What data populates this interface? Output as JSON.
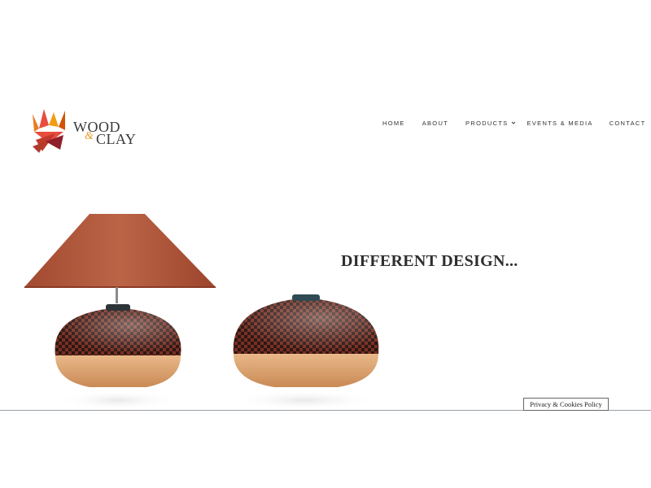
{
  "brand": {
    "word1": "WOOD",
    "ampersand": "&",
    "word2": "CLAY"
  },
  "nav": {
    "home": "HOME",
    "about": "ABOUT",
    "products": "PRODUCTS",
    "events_media": "EVENTS & MEDIA",
    "contact": "CONTACT"
  },
  "hero": {
    "title": "DIFFERENT DESIGN..."
  },
  "footer": {
    "privacy_label": "Privacy & Cookies Policy"
  },
  "colors": {
    "brand_orange": "#e89a2a",
    "brand_red": "#c0392b",
    "lampshade": "#b45a3c",
    "text_dark": "#333333"
  },
  "icons": [
    "logo-mark-icon",
    "chevron-down-icon"
  ]
}
